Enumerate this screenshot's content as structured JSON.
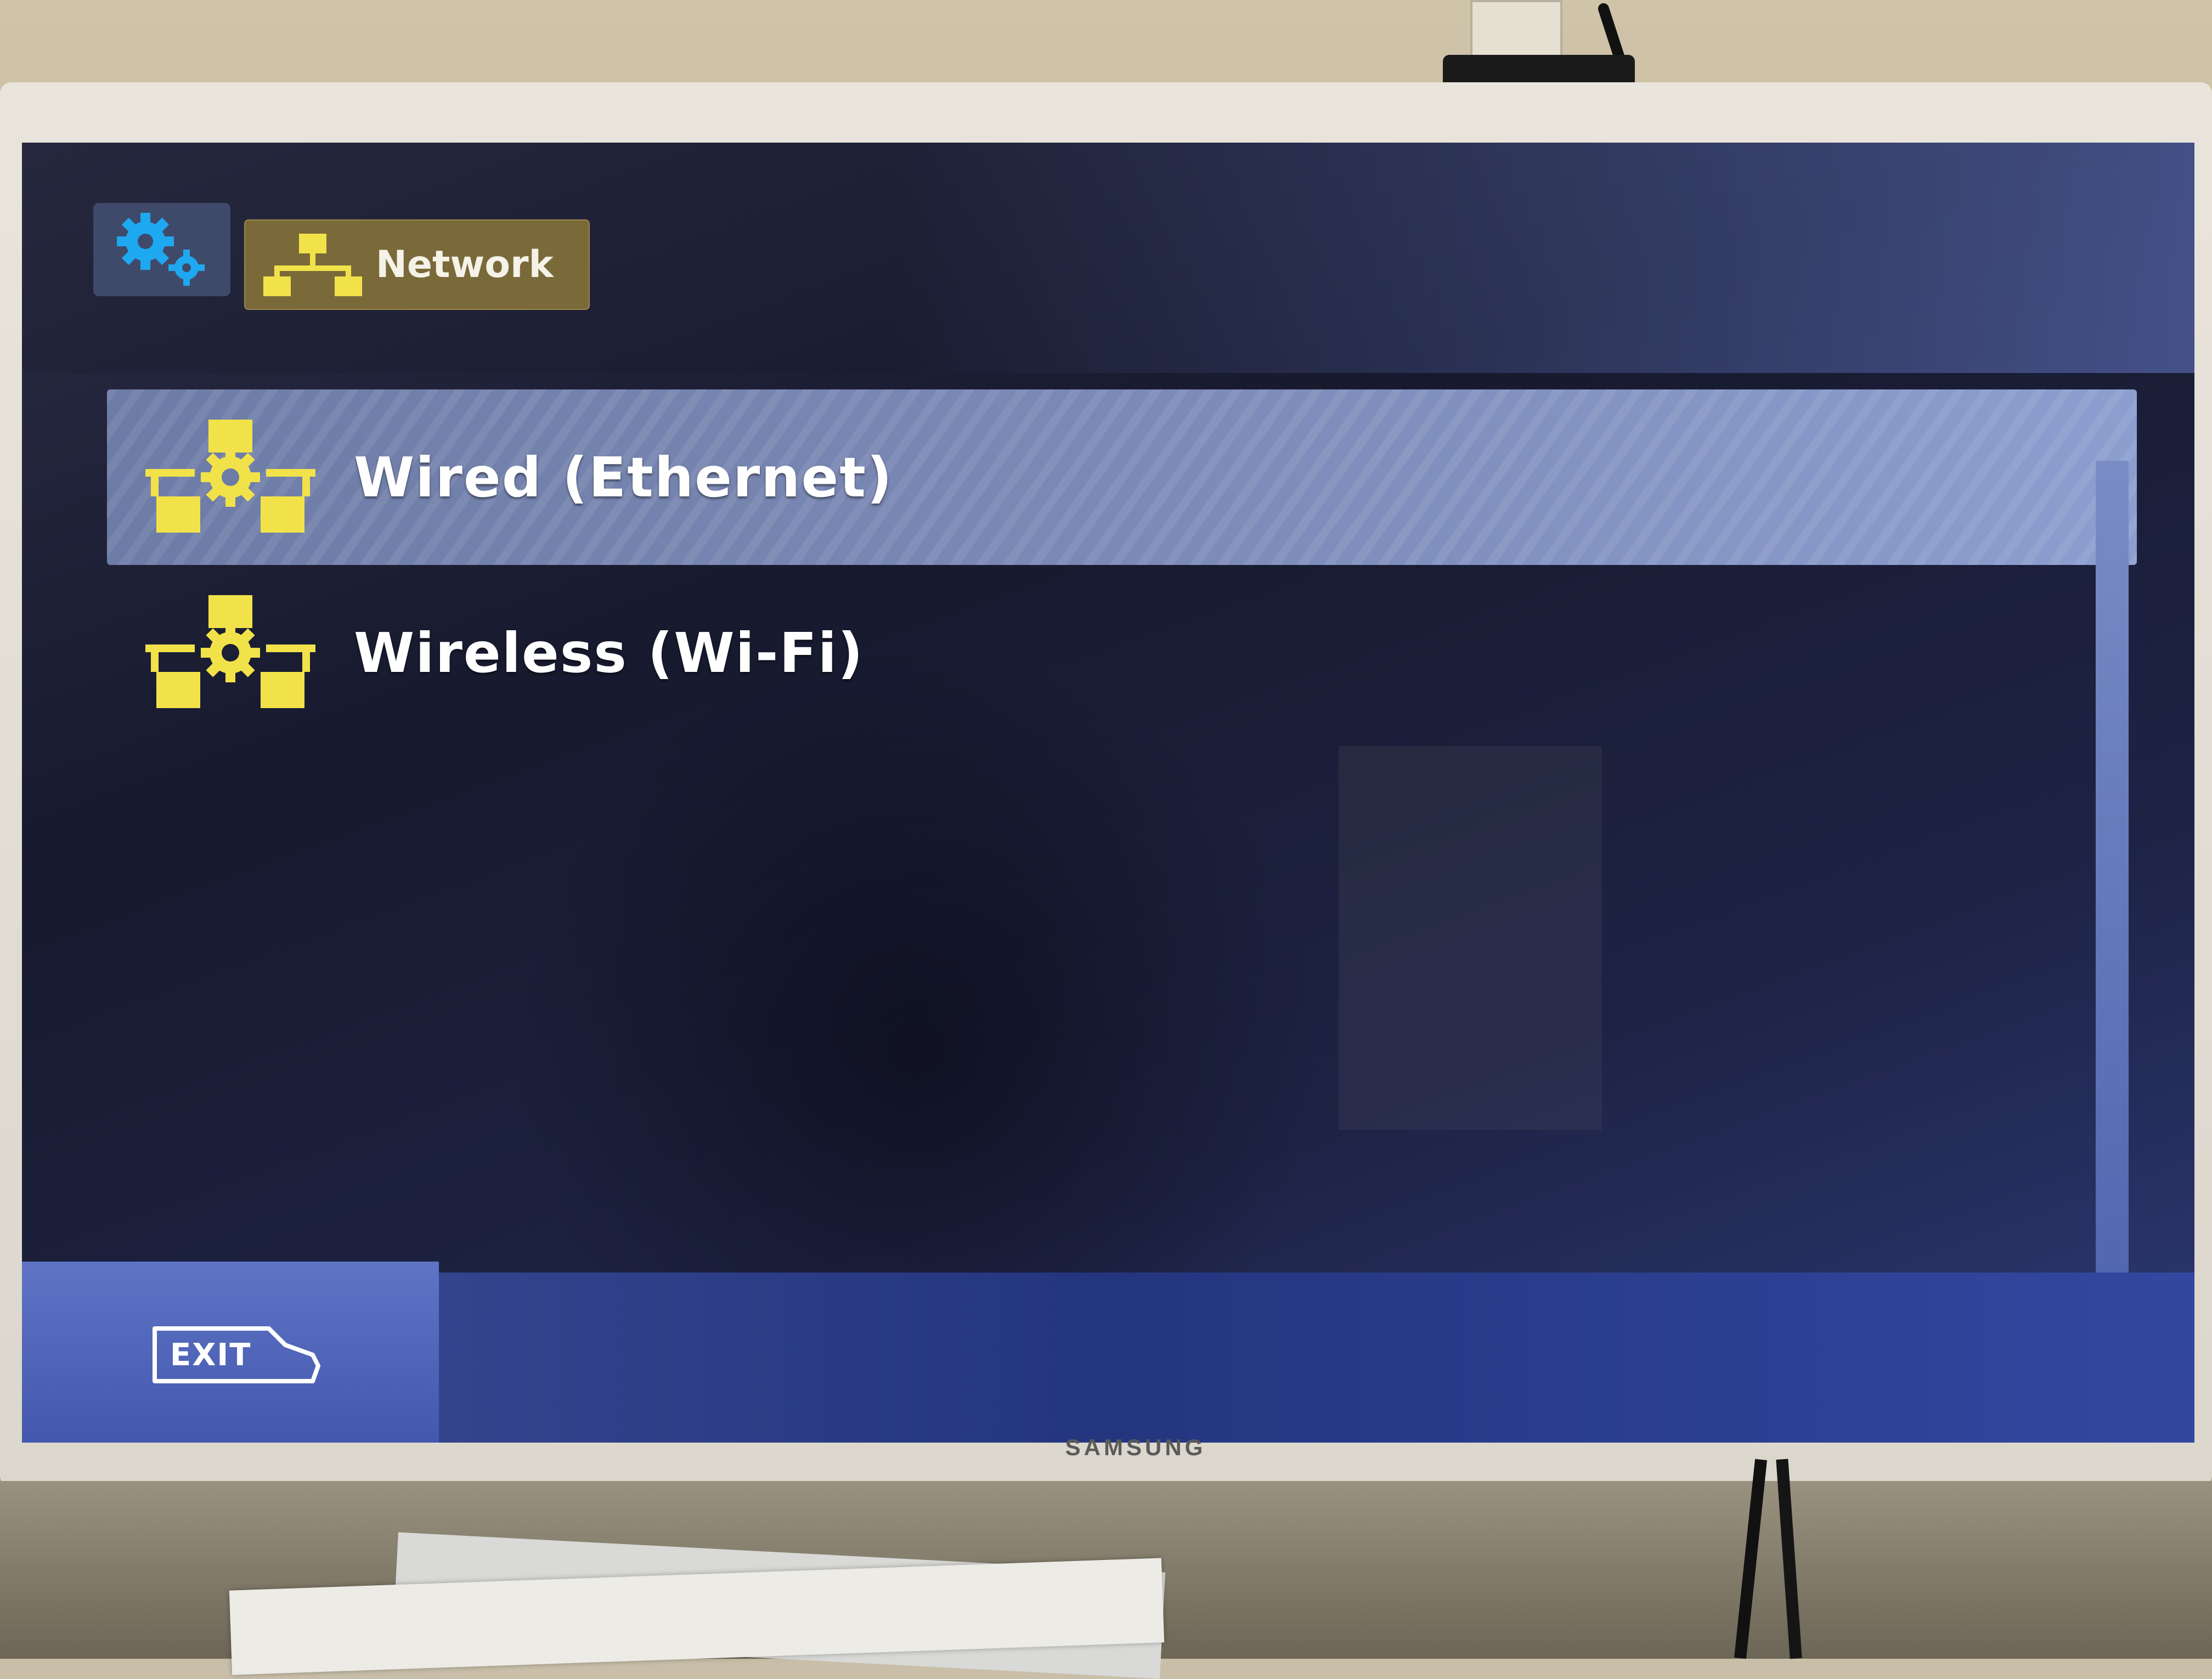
{
  "header": {
    "settings_tab_icon": "gears-icon",
    "network_tab_label": "Network",
    "network_tab_icon": "network-icon"
  },
  "menu": {
    "items": [
      {
        "label": "Wired (Ethernet)",
        "icon": "network-gear-icon",
        "selected": true
      },
      {
        "label": "Wireless (Wi-Fi)",
        "icon": "network-gear-icon",
        "selected": false
      }
    ]
  },
  "footer": {
    "exit_label": "EXIT"
  },
  "device": {
    "brand": "SAMSUNG"
  },
  "colors": {
    "accent_yellow": "#f2e24a",
    "selection": "#7b89b6",
    "gear_blue": "#1ea8f0",
    "background": "#171a2e"
  }
}
